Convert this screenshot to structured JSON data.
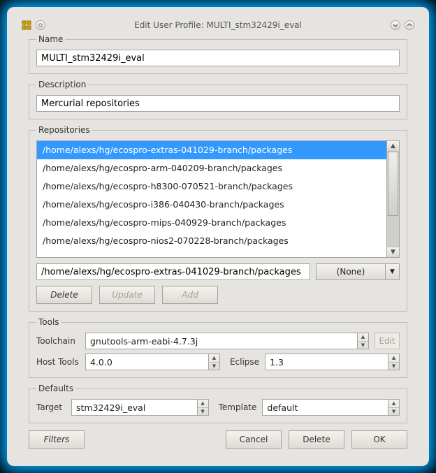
{
  "window": {
    "title": "Edit User Profile: MULTI_stm32429i_eval"
  },
  "name": {
    "legend": "Name",
    "value": "MULTI_stm32429i_eval"
  },
  "description": {
    "legend": "Description",
    "value": "Mercurial repositories"
  },
  "repositories": {
    "legend": "Repositories",
    "items": [
      "/home/alexs/hg/ecospro-extras-041029-branch/packages",
      "/home/alexs/hg/ecospro-arm-040209-branch/packages",
      "/home/alexs/hg/ecospro-h8300-070521-branch/packages",
      "/home/alexs/hg/ecospro-i386-040430-branch/packages",
      "/home/alexs/hg/ecospro-mips-040929-branch/packages",
      "/home/alexs/hg/ecospro-nios2-070228-branch/packages"
    ],
    "selected_index": 0,
    "path_field": "/home/alexs/hg/ecospro-extras-041029-branch/packages",
    "type_select": "(None)",
    "buttons": {
      "delete": "Delete",
      "update": "Update",
      "add": "Add"
    }
  },
  "tools": {
    "legend": "Tools",
    "toolchain_label": "Toolchain",
    "toolchain_value": "gnutools-arm-eabi-4.7.3j",
    "edit_label": "Edit",
    "hosttools_label": "Host Tools",
    "hosttools_value": "4.0.0",
    "eclipse_label": "Eclipse",
    "eclipse_value": "1.3"
  },
  "defaults": {
    "legend": "Defaults",
    "target_label": "Target",
    "target_value": "stm32429i_eval",
    "template_label": "Template",
    "template_value": "default"
  },
  "footer": {
    "filters": "Filters",
    "cancel": "Cancel",
    "delete": "Delete",
    "ok": "OK"
  }
}
